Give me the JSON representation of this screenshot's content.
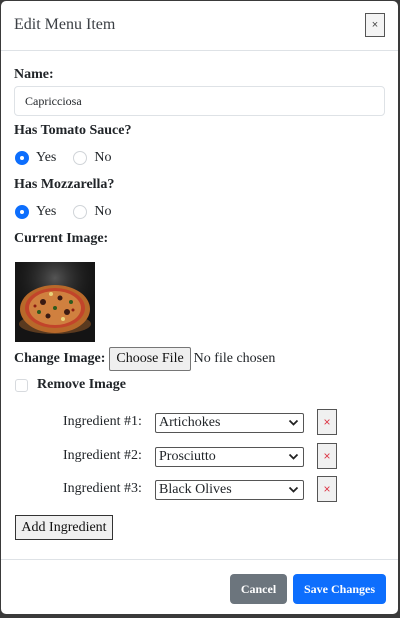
{
  "modal": {
    "title": "Edit Menu Item",
    "close_label": "×"
  },
  "form": {
    "name_label": "Name:",
    "name_value": "Capricciosa",
    "tomato": {
      "label": "Has Tomato Sauce?",
      "yes": "Yes",
      "no": "No",
      "selected": "Yes"
    },
    "mozzarella": {
      "label": "Has Mozzarella?",
      "yes": "Yes",
      "no": "No",
      "selected": "Yes"
    },
    "current_image_label": "Current Image:",
    "change_image_label": "Change Image:",
    "choose_file_label": "Choose File",
    "no_file_text": "No file chosen",
    "remove_image_label": "Remove Image",
    "ingredients": [
      {
        "label": "Ingredient #1:",
        "value": "Artichokes",
        "remove": "×"
      },
      {
        "label": "Ingredient #2:",
        "value": "Prosciutto",
        "remove": "×"
      },
      {
        "label": "Ingredient #3:",
        "value": "Black Olives",
        "remove": "×"
      }
    ],
    "add_ingredient_label": "Add Ingredient"
  },
  "footer": {
    "cancel_label": "Cancel",
    "save_label": "Save Changes"
  },
  "colors": {
    "primary": "#0d6efd",
    "secondary": "#6c757d",
    "danger": "#dc3545"
  }
}
